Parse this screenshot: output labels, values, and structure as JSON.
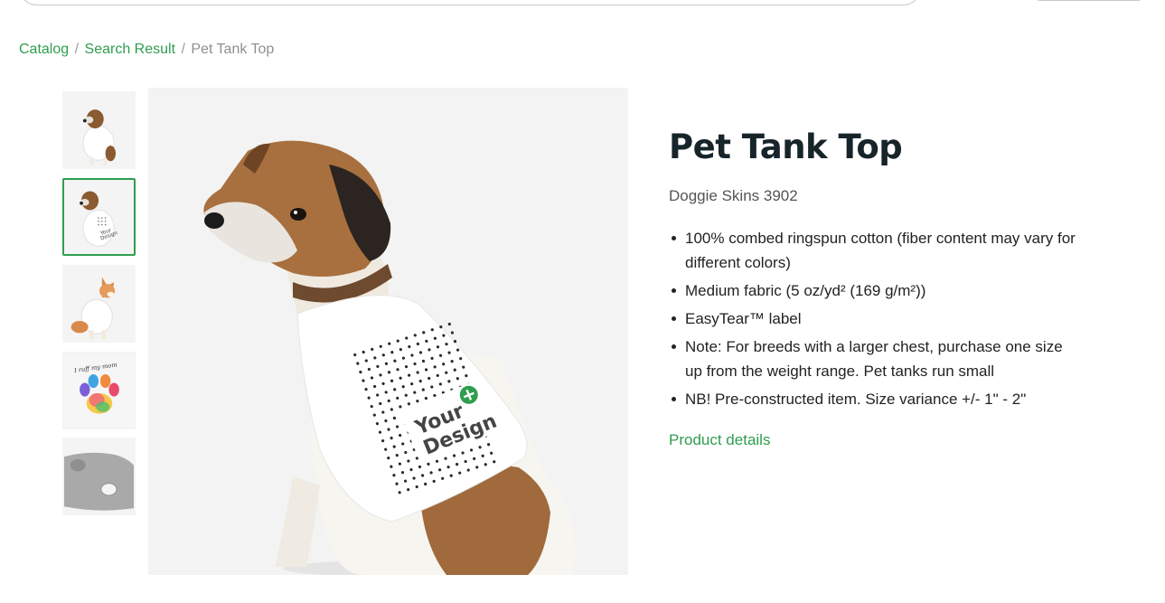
{
  "breadcrumb": {
    "items": [
      "Catalog",
      "Search Result"
    ],
    "separator": "/",
    "current": "Pet Tank Top"
  },
  "product": {
    "title": "Pet Tank Top",
    "brand_model": "Doggie Skins 3902",
    "features": [
      "100% combed ringspun cotton (fiber content may vary for different colors)",
      "Medium fabric (5 oz/yd² (169 g/m²))",
      "EasyTear™ label",
      "Note: For breeds with a larger chest, purchase one size up from the weight range. Pet tanks run small",
      "NB! Pre-constructed item. Size variance +/- 1\" - 2\""
    ],
    "details_link": "Product details"
  },
  "gallery": {
    "placeholder_line1": "Your",
    "placeholder_line2": "Design",
    "thumb_print_text": "I ruff my mom",
    "active_thumbnail_index": 1
  },
  "colors": {
    "accent": "#2f9e4f",
    "title": "#17242a"
  }
}
